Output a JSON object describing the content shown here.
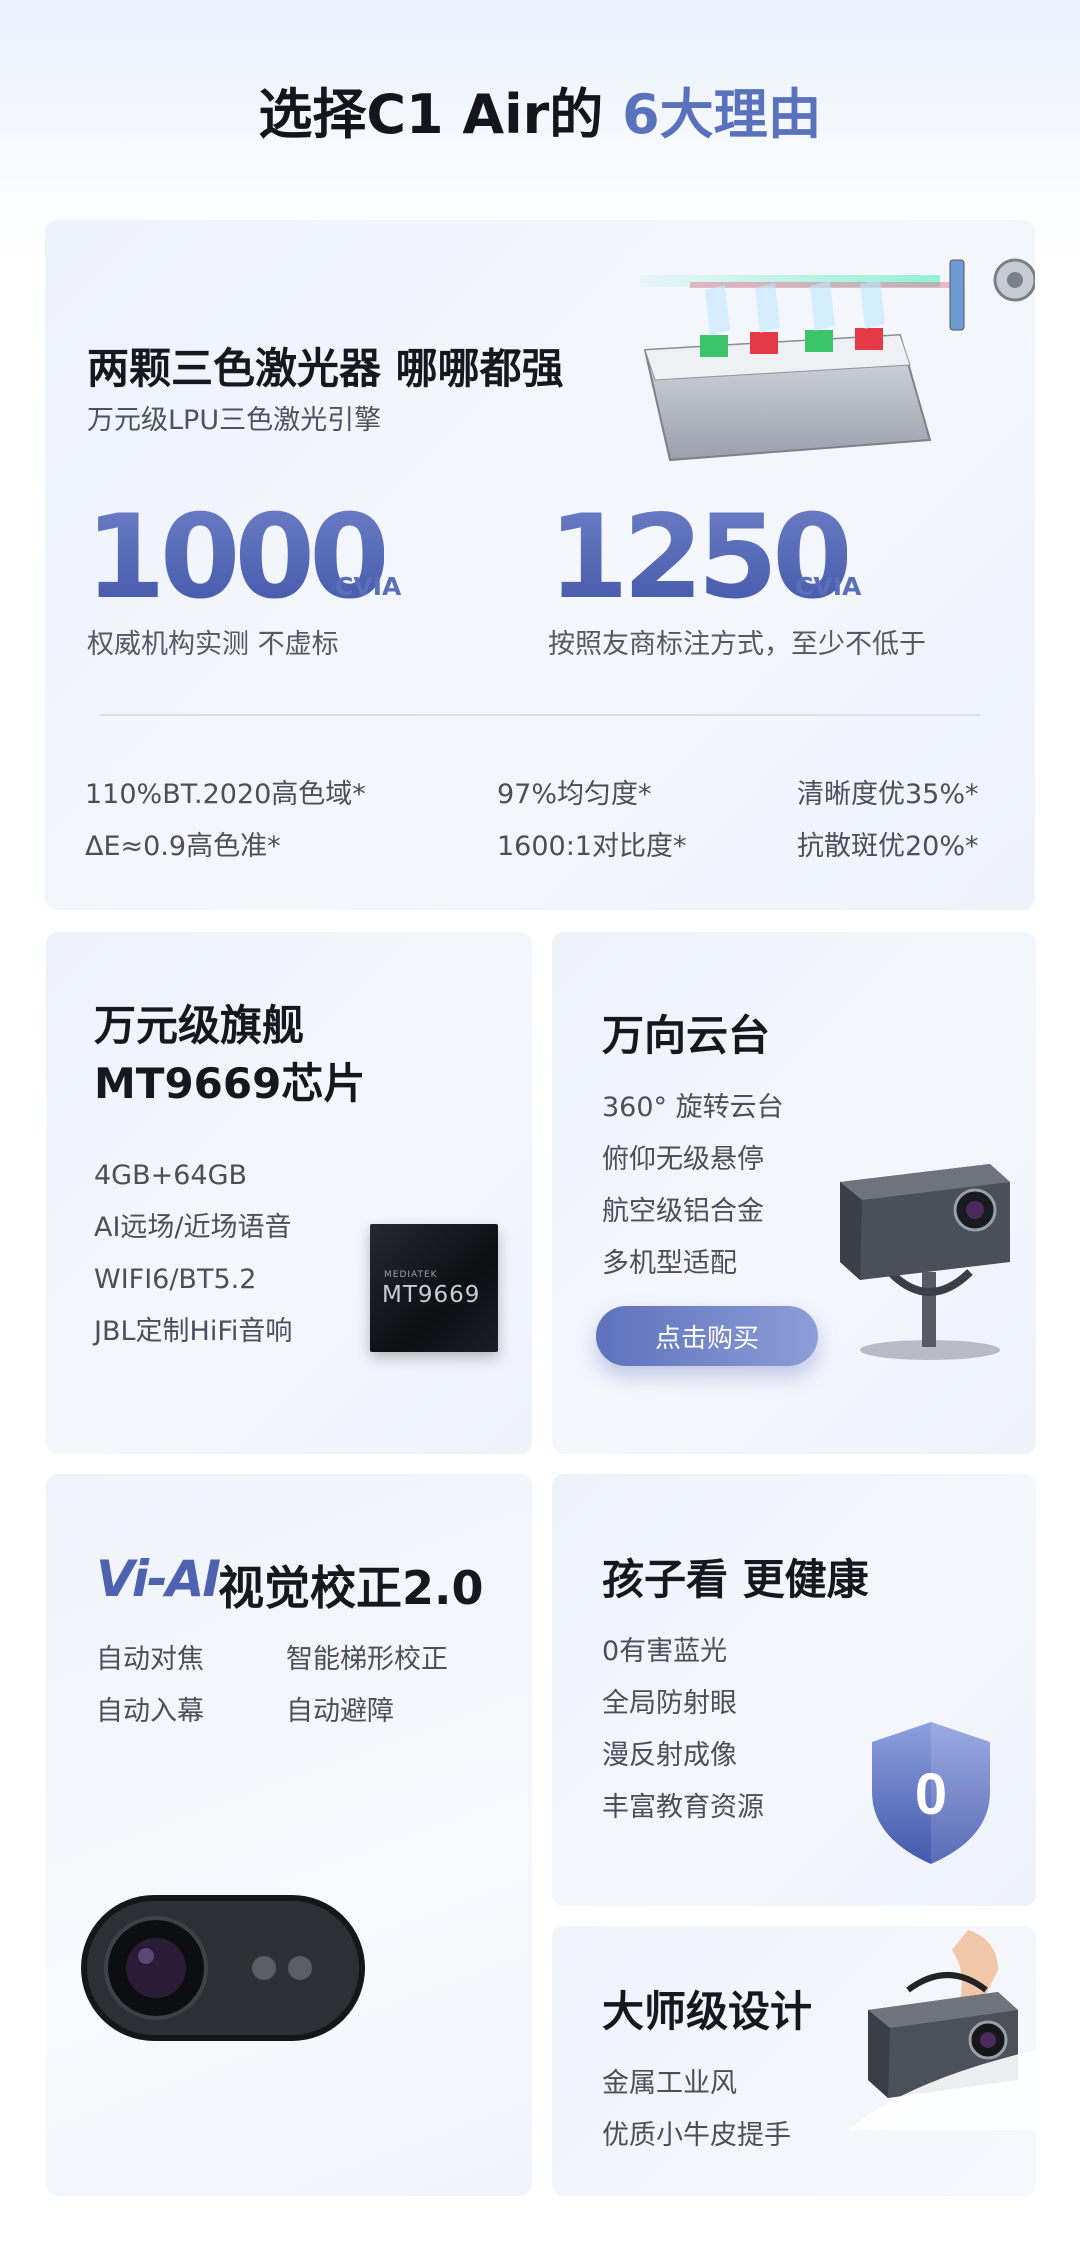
{
  "header": {
    "title_main": "选择C1 Air的 ",
    "title_accent": "6大理由"
  },
  "laser": {
    "title": "两颗三色激光器 哪哪都强",
    "subtitle": "万元级LPU三色激光引擎",
    "stat1_value": "1000",
    "stat1_unit": "CVIA",
    "stat1_caption": "权威机构实测 不虚标",
    "stat2_value": "1250",
    "stat2_unit": "CVIA",
    "stat2_caption": "按照友商标注方式，至少不低于",
    "specs": [
      "110%BT.2020高色域*",
      "97%均匀度*",
      "清晰度优35%*",
      "ΔE≈0.9高色准*",
      "1600:1对比度*",
      "抗散斑优20%*"
    ]
  },
  "chip": {
    "title_line1": "万元级旗舰",
    "title_line2": "MT9669芯片",
    "items": [
      "4GB+64GB",
      "AI远场/近场语音",
      "WIFI6/BT5.2",
      "JBL定制HiFi音响"
    ],
    "chip_brand": "MEDIATEK",
    "chip_model": "MT9669"
  },
  "gimbal": {
    "title": "万向云台",
    "items": [
      "360°  旋转云台",
      "俯仰无级悬停",
      "航空级铝合金",
      "多机型适配"
    ],
    "buy_label": "点击购买"
  },
  "vi_ai": {
    "logo": "Vi-AI",
    "title": "视觉校正2.0",
    "features": [
      "自动对焦",
      "智能梯形校正",
      "自动入幕",
      "自动避障"
    ]
  },
  "eye": {
    "title": "孩子看 更健康",
    "items": [
      "0有害蓝光",
      "全局防射眼",
      "漫反射成像",
      "丰富教育资源"
    ],
    "shield_text": "0"
  },
  "design": {
    "title": "大师级设计",
    "items": [
      "金属工业风",
      "优质小牛皮提手"
    ]
  },
  "colors": {
    "accent": "#5a72bd",
    "card_bg": "#eef2fb",
    "button_start": "#5e72bd",
    "button_end": "#8d9dd6"
  }
}
